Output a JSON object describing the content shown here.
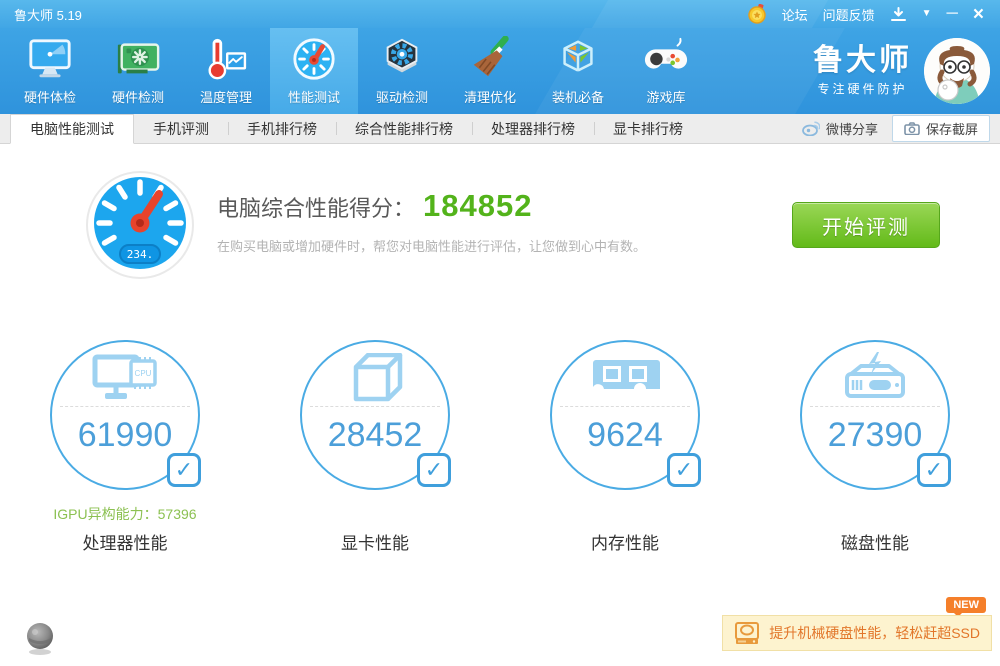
{
  "titlebar": {
    "title": "鲁大师 5.19",
    "forum": "论坛",
    "feedback": "问题反馈",
    "minimize": "─",
    "close": "×",
    "dropdown": "▼"
  },
  "toolbar": {
    "items": [
      {
        "label": "硬件体检",
        "icon": "monitor-scan"
      },
      {
        "label": "硬件检测",
        "icon": "graphics-card"
      },
      {
        "label": "温度管理",
        "icon": "thermometer-chart"
      },
      {
        "label": "性能测试",
        "icon": "speed-gauge",
        "active": true
      },
      {
        "label": "驱动检测",
        "icon": "hexagon-gear"
      },
      {
        "label": "清理优化",
        "icon": "broom"
      },
      {
        "label": "装机必备",
        "icon": "cube-box"
      },
      {
        "label": "游戏库",
        "icon": "gamepad"
      }
    ],
    "brand": {
      "name": "鲁大师",
      "slogan": "专注硬件防护"
    }
  },
  "tabs": {
    "items": [
      {
        "label": "电脑性能测试",
        "active": true
      },
      {
        "label": "手机评测"
      },
      {
        "label": "手机排行榜"
      },
      {
        "label": "综合性能排行榜"
      },
      {
        "label": "处理器排行榜"
      },
      {
        "label": "显卡排行榜"
      }
    ],
    "weibo_share": "微博分享",
    "save_screenshot": "保存截屏"
  },
  "hero": {
    "score_label": "电脑综合性能得分：",
    "score": "184852",
    "description": "在购买电脑或增加硬件时，帮您对电脑性能进行评估，让您做到心中有数。",
    "start_button": "开始评测",
    "gauge_display": "234."
  },
  "cards": [
    {
      "score": "61990",
      "label": "处理器性能",
      "icon": "cpu-monitor",
      "extra_label": "IGPU异构能力：",
      "extra_value": "57396",
      "checked": "✓"
    },
    {
      "score": "28452",
      "label": "显卡性能",
      "icon": "wireframe-cube",
      "checked": "✓"
    },
    {
      "score": "9624",
      "label": "内存性能",
      "icon": "ram-module",
      "checked": "✓"
    },
    {
      "score": "27390",
      "label": "磁盘性能",
      "icon": "hard-disk-bolt",
      "checked": "✓"
    }
  ],
  "footer": {
    "new_badge": "NEW",
    "promo": "提升机械硬盘性能，轻松赶超SSD"
  },
  "colors": {
    "titlebar_blue": "#41a6e5",
    "toolbar_blue": "#2f93dc",
    "active_item_blue": "#55b3e9",
    "score_green": "#53b31b",
    "igpu_green": "#8cc152",
    "circle_blue": "#4aabe4",
    "circle_score_blue": "#4c9fd9",
    "button_green": "#63ba19",
    "promo_orange": "#e2762a",
    "promo_bg": "#fdf3cf"
  }
}
